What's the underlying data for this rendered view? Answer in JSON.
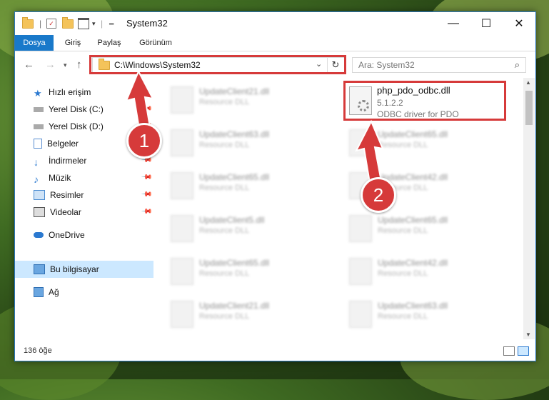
{
  "window": {
    "title": "System32",
    "buttons": {
      "minimize": "—",
      "maximize": "☐",
      "close": "✕"
    }
  },
  "ribbon": {
    "tabs": [
      "Dosya",
      "Giriş",
      "Paylaş",
      "Görünüm"
    ],
    "active": "Dosya"
  },
  "address": {
    "path": "C:\\Windows\\System32",
    "search_placeholder": "Ara: System32"
  },
  "sidebar": {
    "items": [
      {
        "label": "Hızlı erişim"
      },
      {
        "label": "Yerel Disk (C:)"
      },
      {
        "label": "Yerel Disk (D:)"
      },
      {
        "label": "Belgeler"
      },
      {
        "label": "İndirmeler"
      },
      {
        "label": "Müzik"
      },
      {
        "label": "Resimler"
      },
      {
        "label": "Videolar"
      },
      {
        "label": "OneDrive"
      },
      {
        "label": "Bu bilgisayar"
      },
      {
        "label": "Ağ"
      }
    ]
  },
  "files": [
    {
      "name": "UpdateClient21.dll",
      "desc": "Resource DLL"
    },
    {
      "name": "UpdateClient63.dll",
      "desc": "Resource DLL"
    },
    {
      "name": "UpdateClient65.dll",
      "desc": "Resource DLL"
    },
    {
      "name": "UpdateClient65.dll",
      "desc": "Resource DLL"
    },
    {
      "name": "UpdateClient42.dll",
      "desc": "Resource DLL"
    },
    {
      "name": "UpdateClient5.dll",
      "desc": "Resource DLL"
    },
    {
      "name": "UpdateClient65.dll",
      "desc": "Resource DLL"
    },
    {
      "name": "UpdateClient65.dll",
      "desc": "Resource DLL"
    },
    {
      "name": "UpdateClient42.dll",
      "desc": "Resource DLL"
    },
    {
      "name": "UpdateClient21.dll",
      "desc": "Resource DLL"
    },
    {
      "name": "UpdateClient63.dll",
      "desc": "Resource DLL"
    }
  ],
  "selected_file": {
    "name": "php_pdo_odbc.dll",
    "version": "5.1.2.2",
    "description": "ODBC driver for PDO"
  },
  "status": {
    "count": "136 öğe"
  },
  "annotations": {
    "step1": "1",
    "step2": "2"
  },
  "colors": {
    "accent": "#1979ca",
    "highlight": "#d63a3a"
  }
}
